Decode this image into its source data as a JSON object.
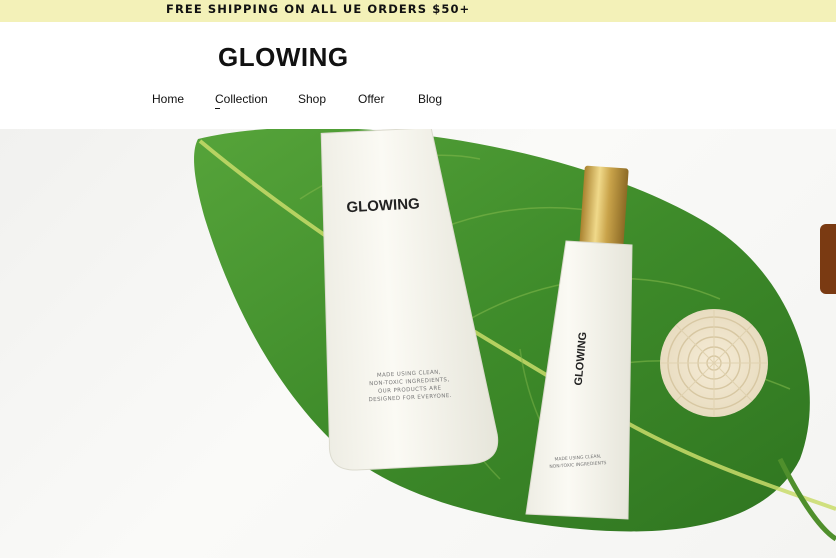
{
  "announcement": {
    "text": "FREE SHIPPING ON ALL UE ORDERS $50+"
  },
  "header": {
    "logo": "GLOWING",
    "nav": [
      {
        "label": "Home"
      },
      {
        "label": "Collection"
      },
      {
        "label": "Shop"
      },
      {
        "label": "Offer"
      },
      {
        "label": "Blog"
      }
    ]
  },
  "hero": {
    "product_large": {
      "brand": "GLOWING",
      "tagline_lines": [
        "MADE USING CLEAN,",
        "NON-TOXIC INGREDIENTS,",
        "OUR PRODUCTS ARE",
        "DESIGNED FOR EVERYONE."
      ]
    },
    "product_small": {
      "brand": "GLOWING",
      "tagline_lines": [
        "MADE USING CLEAN,",
        "NON-TOXIC INGREDIENTS"
      ]
    }
  },
  "colors": {
    "announcement_bg": "#f3f1b8",
    "leaf": "#3f8f2a",
    "tube": "#f7f6ee",
    "cap_gold": "#c9a34a"
  }
}
